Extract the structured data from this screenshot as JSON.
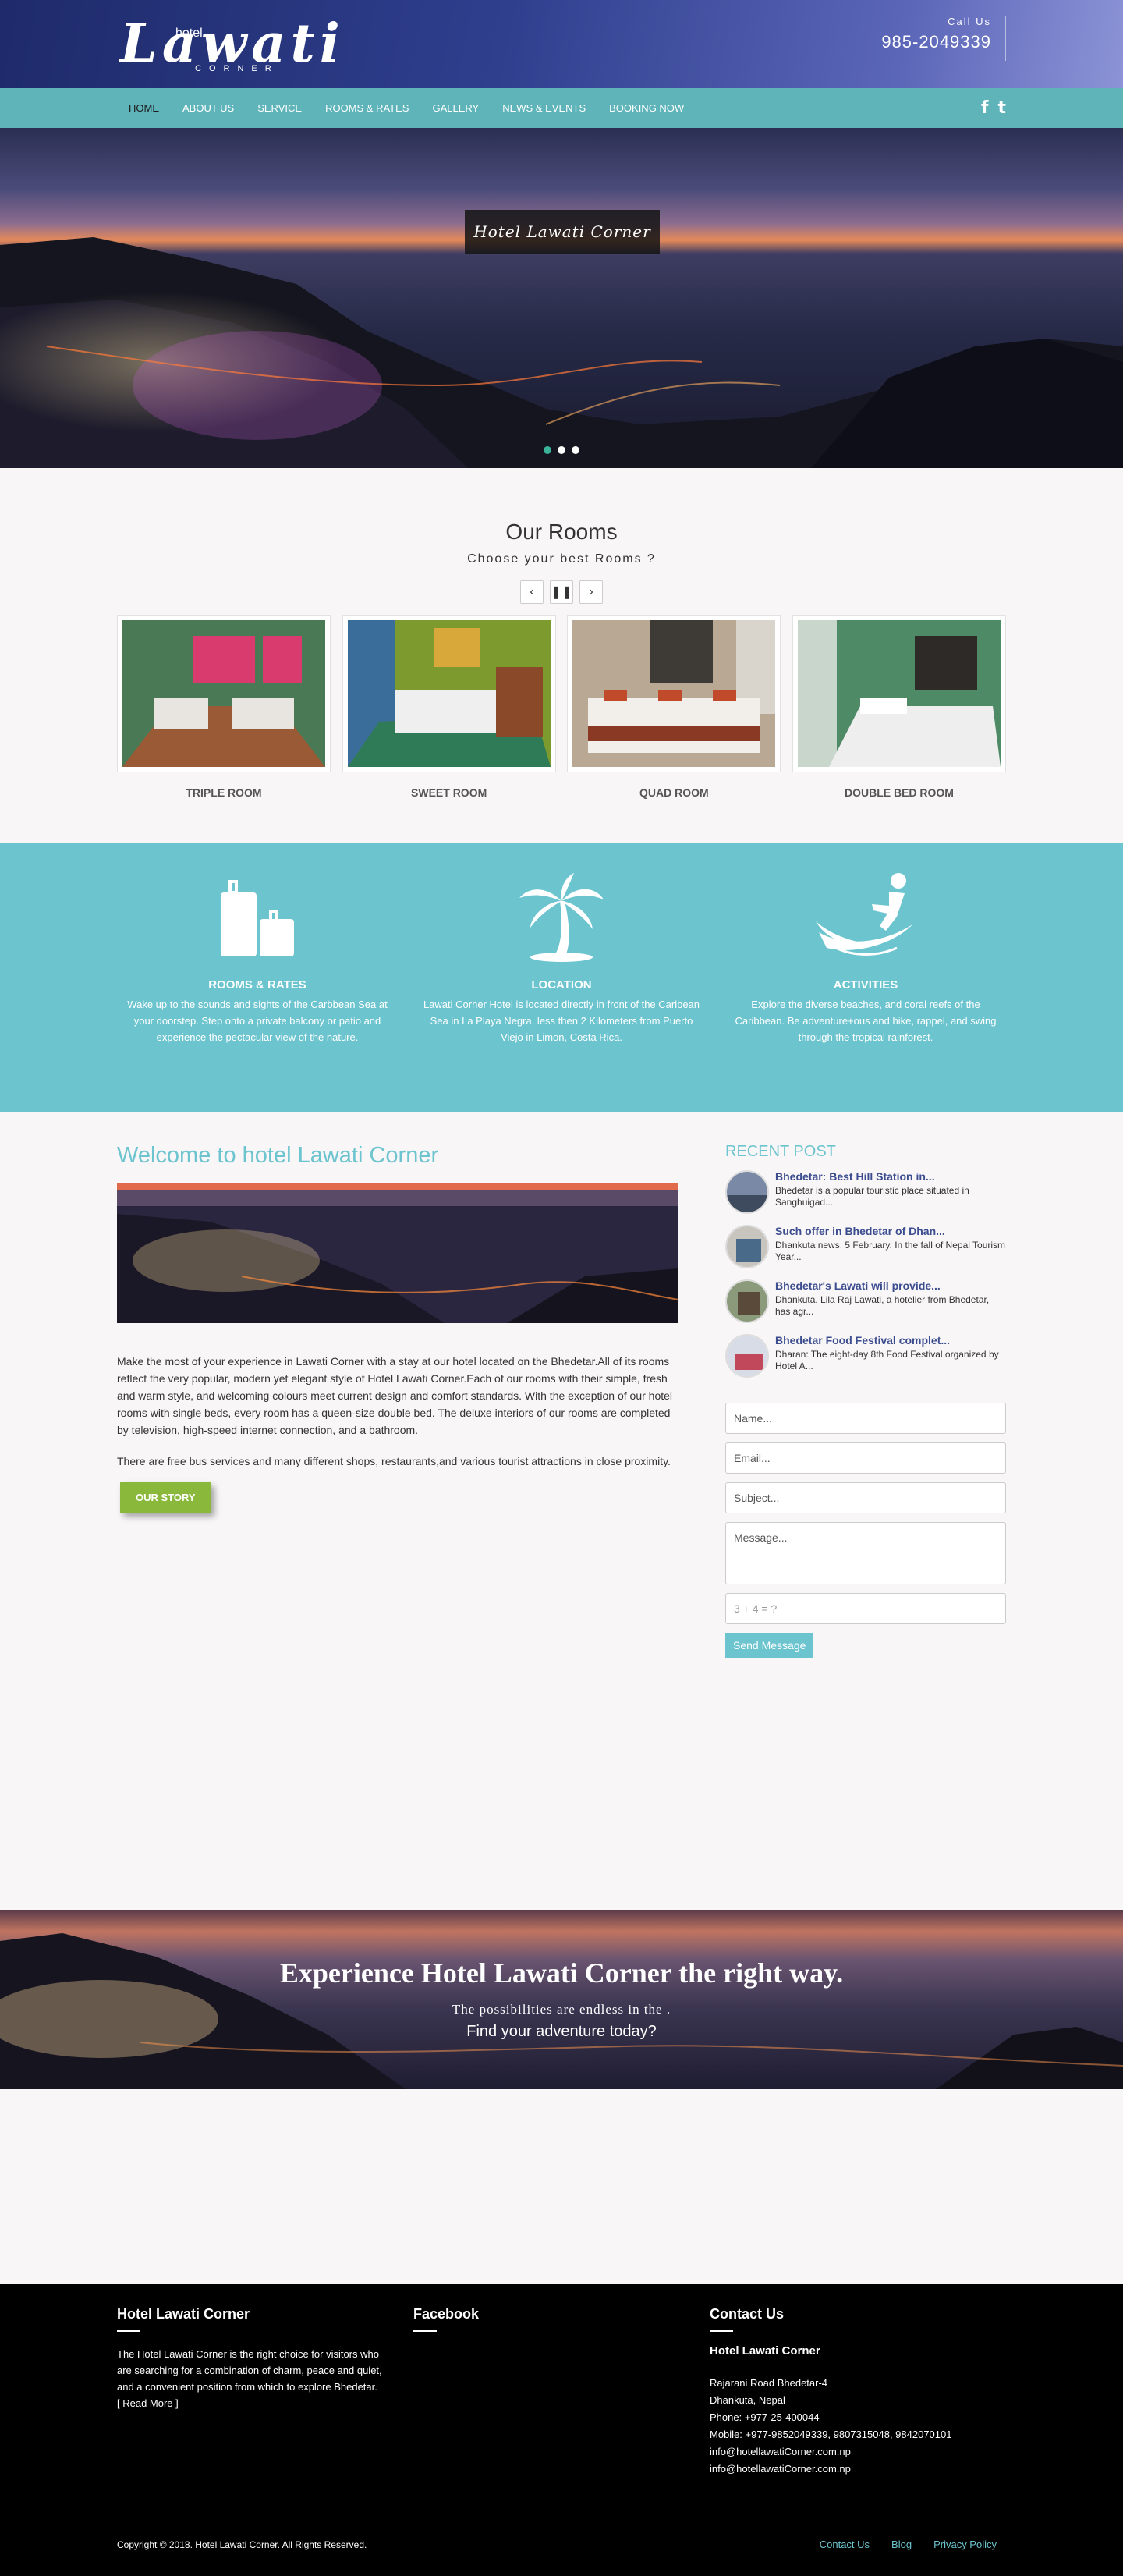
{
  "header": {
    "logo_small": "hotel",
    "logo_big": "Lawati",
    "logo_sub": "CORNER",
    "call_label": "Call Us",
    "call_number": "985-2049339"
  },
  "nav": {
    "items": [
      "HOME",
      "ABOUT US",
      "SERVICE",
      "ROOMS & RATES",
      "GALLERY",
      "NEWS & EVENTS",
      "BOOKING NOW"
    ],
    "social": [
      "f",
      "t"
    ]
  },
  "hero": {
    "caption": "Hotel Lawati Corner"
  },
  "rooms": {
    "title": "Our Rooms",
    "subtitle": "Choose your best Rooms ?",
    "controls": [
      "‹",
      "❚❚",
      "›"
    ],
    "items": [
      {
        "name": "TRIPLE ROOM"
      },
      {
        "name": "SWEET ROOM"
      },
      {
        "name": "QUAD ROOM"
      },
      {
        "name": "DOUBLE BED ROOM"
      }
    ]
  },
  "features": [
    {
      "title": "ROOMS & RATES",
      "text": "Wake up to the sounds and sights of the Carbbean Sea at your doorstep. Step onto a private balcony or patio and experience the pectacular view of the nature.",
      "icon": "luggage-icon"
    },
    {
      "title": "LOCATION",
      "text": "Lawati Corner Hotel is located directly in front of the Caribean Sea in La Playa Negra, less then 2 Kilometers from Puerto Viejo in Limon, Costa Rica.",
      "icon": "palm-tree-icon"
    },
    {
      "title": "ACTIVITIES",
      "text": "Explore the diverse beaches, and coral reefs of the Caribbean. Be adventure+ous and hike, rappel, and swing through the tropical rainforest.",
      "icon": "surfer-icon"
    }
  ],
  "welcome": {
    "title": "Welcome to hotel Lawati Corner",
    "para1": "Make the most of your experience in Lawati Corner with a stay at our hotel located on the Bhedetar.All of its rooms reflect the very popular, modern yet elegant style of Hotel Lawati Corner.Each of our rooms with their simple, fresh and warm style, and welcoming colours meet current design and comfort standards. With the exception of our hotel rooms with single beds, every room has a queen-size double bed. The deluxe interiors of our rooms are completed by television, high-speed internet connection, and a bathroom.",
    "para2": "There are free bus services and many different shops, restaurants,and various tourist attractions in close proximity.",
    "button": "OUR STORY"
  },
  "recent": {
    "title": "RECENT POST",
    "posts": [
      {
        "title": "Bhedetar: Best Hill Station in...",
        "excerpt": "Bhedetar is a popular touristic place situated in Sanghuigad..."
      },
      {
        "title": "Such offer in Bhedetar of Dhan...",
        "excerpt": "Dhankuta news, 5 February. In the fall of Nepal Tourism Year..."
      },
      {
        "title": "Bhedetar's Lawati will provide...",
        "excerpt": "Dhankuta. Lila Raj Lawati, a hotelier from Bhedetar, has agr..."
      },
      {
        "title": "Bhedetar Food Festival complet...",
        "excerpt": "Dharan: The eight-day 8th Food Festival organized by Hotel A..."
      }
    ]
  },
  "contact_form": {
    "name": "Name...",
    "email": "Email...",
    "subject": "Subject...",
    "message": "Message...",
    "captcha": "3 + 4 = ?",
    "send": "Send Message"
  },
  "banner": {
    "title": "Experience Hotel Lawati Corner the right way.",
    "line2": "The possibilities are endless in the .",
    "line3": "Find your adventure today?"
  },
  "footer": {
    "col1_title": "Hotel Lawati Corner",
    "col1_text": "The Hotel Lawati Corner is the right choice for visitors who are searching for a combination of charm, peace and quiet, and a convenient position from which to explore Bhedetar.",
    "read_more": "[ Read More ]",
    "col2_title": "Facebook",
    "col3_title": "Contact Us",
    "company": "Hotel Lawati Corner",
    "address1": "Rajarani Road Bhedetar-4",
    "address2": "Dhankuta, Nepal",
    "phone": "Phone: +977-25-400044",
    "mobile": "Mobile: +977-9852049339, 9807315048, 9842070101",
    "email1": "info@hotellawatiCorner.com.np",
    "email2": "info@hotellawatiCorner.com.np",
    "copyright": "Copyright © 2018. Hotel Lawati Corner. All Rights Reserved.",
    "links": [
      "Contact Us",
      "Blog",
      "Privacy Policy"
    ]
  },
  "colors": {
    "accent": "#6cc4cf",
    "nav": "#5fb4ba",
    "button_green": "#8ab83a",
    "post_title": "#3c4d8f",
    "footer": "#000000"
  }
}
